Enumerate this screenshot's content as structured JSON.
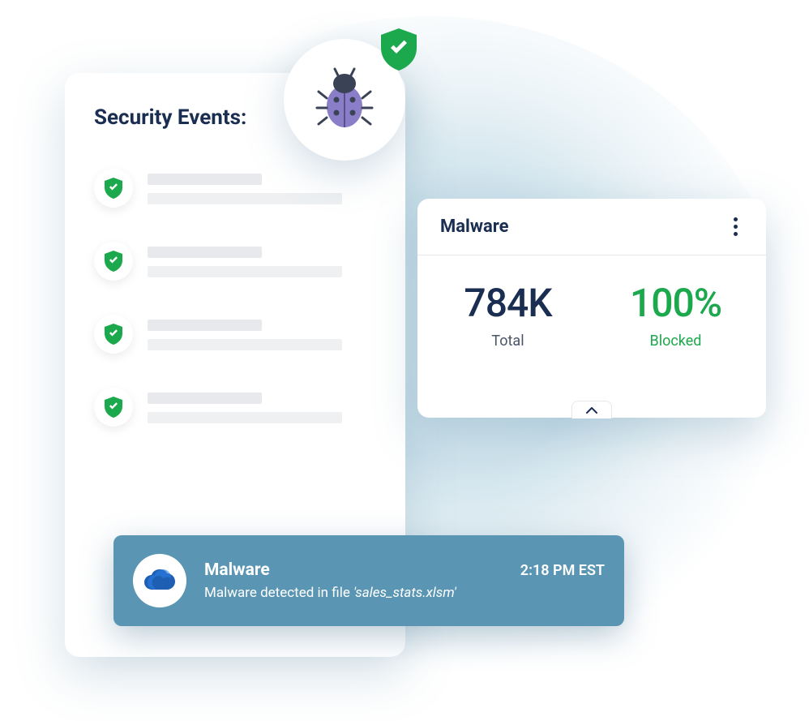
{
  "events_panel": {
    "title": "Security Events:",
    "items": [
      {
        "status": "ok"
      },
      {
        "status": "ok"
      },
      {
        "status": "ok"
      },
      {
        "status": "ok"
      }
    ]
  },
  "malware_card": {
    "title": "Malware",
    "total_value": "784K",
    "total_label": "Total",
    "blocked_value": "100%",
    "blocked_label": "Blocked"
  },
  "alert": {
    "title": "Malware",
    "time": "2:18 PM EST",
    "desc_prefix": "Malware detected in file ",
    "file": "'sales_stats.xlsm'"
  },
  "icons": {
    "bug": "bug-icon",
    "shield": "shield-check-icon",
    "cloud": "cloud-icon",
    "kebab": "more-vertical-icon",
    "chevron": "chevron-up-icon"
  }
}
